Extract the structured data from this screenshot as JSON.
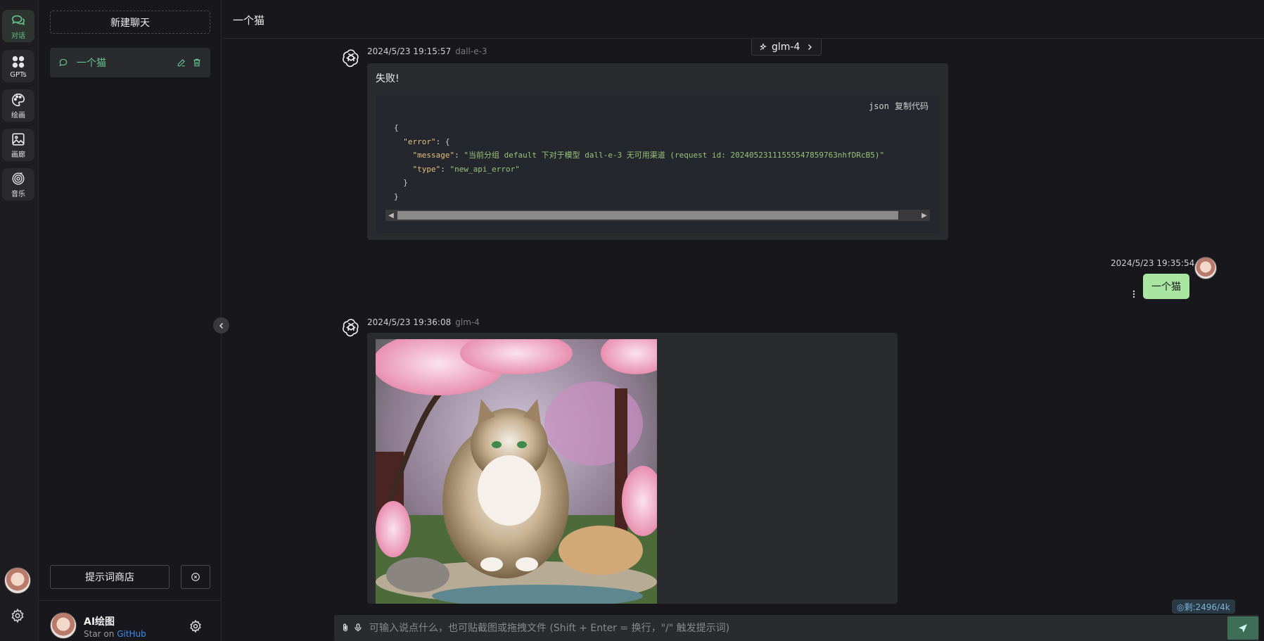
{
  "rail": {
    "items": [
      {
        "label": "对话",
        "icon": "chat-icon",
        "active": true
      },
      {
        "label": "GPTs",
        "icon": "apps-icon"
      },
      {
        "label": "绘画",
        "icon": "palette-icon"
      },
      {
        "label": "画廊",
        "icon": "gallery-icon"
      },
      {
        "label": "音乐",
        "icon": "music-icon"
      }
    ]
  },
  "sidebar": {
    "new_chat_label": "新建聊天",
    "chats": [
      {
        "title": "一个猫",
        "active": true
      }
    ],
    "prompt_store_label": "提示词商店",
    "footer": {
      "name": "AI绘图",
      "sub_prefix": "Star on ",
      "sub_link": "GitHub"
    }
  },
  "header": {
    "title": "一个猫"
  },
  "model_selector": {
    "label": "glm-4"
  },
  "messages": [
    {
      "role": "assistant",
      "time": "2024/5/23 19:15:57",
      "model": "dall-e-3",
      "text": "失败!",
      "code": {
        "lang": "json",
        "copy_label": "复制代码",
        "lines": {
          "l1": "{",
          "l2_key": "\"error\"",
          "l2_rest": ": {",
          "l3_key": "\"message\"",
          "l3_sep": ": ",
          "l3_val": "\"当前分组 default 下对于模型 dall-e-3 无可用渠道 (request id: 20240523111555547859763nhfDRcB5)\"",
          "l4_key": "\"type\"",
          "l4_sep": ": ",
          "l4_val": "\"new_api_error\"",
          "l5": "}",
          "l6": "}"
        }
      }
    },
    {
      "role": "user",
      "time": "2024/5/23 19:35:54",
      "text": "一个猫"
    },
    {
      "role": "assistant",
      "time": "2024/5/23 19:36:08",
      "model": "glm-4",
      "image": "cat-under-cherry-blossoms"
    }
  ],
  "token_badge": "◎剩:2496/4k",
  "input": {
    "placeholder": "可输入说点什么，也可贴截图或拖拽文件 (Shift + Enter = 换行，\"/\" 触发提示词)"
  },
  "colors": {
    "accent_green": "#63c28a",
    "user_bubble": "#a8e6a1",
    "send_button": "#3e6e57",
    "link": "#3b8cf0"
  }
}
